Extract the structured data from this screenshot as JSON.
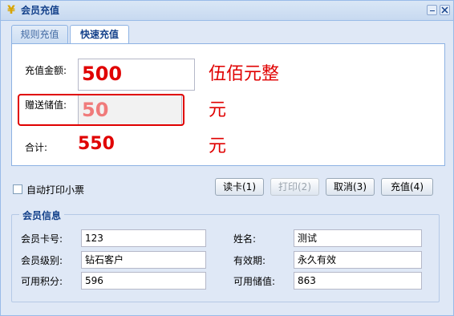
{
  "window": {
    "title": "会员充值",
    "icon": "yen-icon"
  },
  "tabs": [
    {
      "label": "规则充值",
      "active": false
    },
    {
      "label": "快速充值",
      "active": true
    }
  ],
  "recharge": {
    "amount_label": "充值金额:",
    "amount_value": "500",
    "amount_chinese": "伍佰元整",
    "gift_label": "赠送储值:",
    "gift_value": "50",
    "gift_unit": "元",
    "total_label": "合计:",
    "total_value": "550",
    "total_unit": "元"
  },
  "options": {
    "auto_print_label": "自动打印小票",
    "auto_print_checked": false
  },
  "buttons": {
    "read_card": "读卡(1)",
    "print": "打印(2)",
    "cancel": "取消(3)",
    "recharge": "充值(4)"
  },
  "member_info": {
    "legend": "会员信息",
    "card_no_label": "会员卡号:",
    "card_no": "123",
    "name_label": "姓名:",
    "name": "测试",
    "level_label": "会员级别:",
    "level": "钻石客户",
    "validity_label": "有效期:",
    "validity": "永久有效",
    "points_label": "可用积分:",
    "points": "596",
    "balance_label": "可用储值:",
    "balance": "863"
  },
  "colors": {
    "accent": "#15428b",
    "highlight": "#e00000",
    "window_bg": "#dfe8f6"
  }
}
